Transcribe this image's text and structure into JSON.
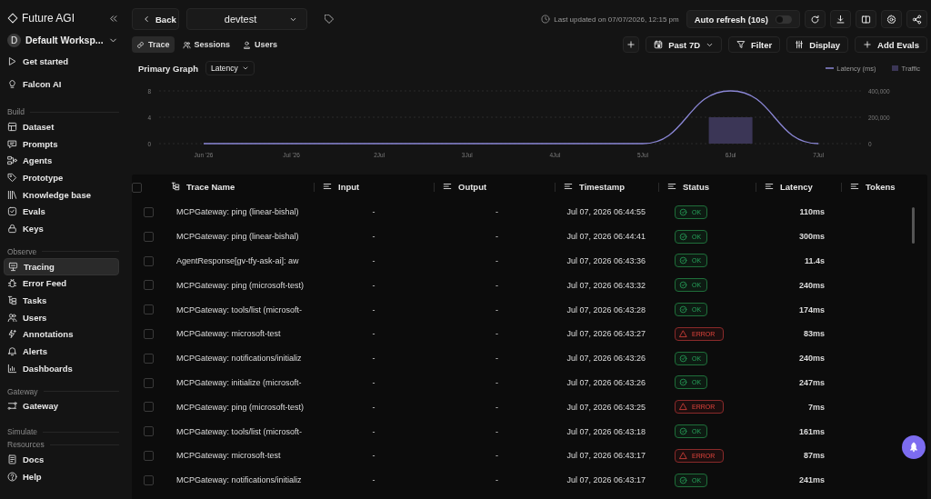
{
  "app": {
    "name": "Future AGI"
  },
  "workspace": {
    "initial": "D",
    "name": "Default Worksp..."
  },
  "sidebar": {
    "top_items": [
      {
        "label": "Get started",
        "selected": false
      },
      {
        "label": "Falcon AI",
        "selected": false
      }
    ],
    "sections": [
      {
        "title": "Build",
        "items": [
          {
            "label": "Dataset",
            "selected": false
          },
          {
            "label": "Prompts",
            "selected": false
          },
          {
            "label": "Agents",
            "selected": false
          },
          {
            "label": "Prototype",
            "selected": false
          },
          {
            "label": "Knowledge base",
            "selected": false
          },
          {
            "label": "Evals",
            "selected": false
          },
          {
            "label": "Keys",
            "selected": false
          }
        ]
      },
      {
        "title": "Observe",
        "items": [
          {
            "label": "Tracing",
            "selected": true
          },
          {
            "label": "Error Feed",
            "selected": false
          },
          {
            "label": "Tasks",
            "selected": false
          },
          {
            "label": "Users",
            "selected": false
          },
          {
            "label": "Annotations",
            "selected": false
          },
          {
            "label": "Alerts",
            "selected": false
          },
          {
            "label": "Dashboards",
            "selected": false
          }
        ]
      },
      {
        "title": "Gateway",
        "items": [
          {
            "label": "Gateway",
            "selected": false
          }
        ]
      },
      {
        "title": "Simulate"
      },
      {
        "title": "Resources",
        "items": [
          {
            "label": "Docs",
            "selected": false
          },
          {
            "label": "Help",
            "selected": false
          }
        ]
      }
    ]
  },
  "topbar": {
    "back": "Back",
    "project": "devtest",
    "last_updated": "Last updated on 07/07/2026, 12:15 pm",
    "auto_refresh": {
      "label": "Auto refresh (10s)",
      "on": false
    }
  },
  "tabs": [
    {
      "label": "Trace",
      "selected": true
    },
    {
      "label": "Sessions",
      "selected": false
    },
    {
      "label": "Users",
      "selected": false
    }
  ],
  "actions": {
    "range": "Past 7D",
    "filter": "Filter",
    "display": "Display",
    "add_evals": "Add Evals"
  },
  "graph": {
    "title": "Primary Graph",
    "metric": "Latency",
    "chart_data": {
      "type": "line",
      "categories": [
        "Jun '26",
        "Jul '26",
        "2Jul",
        "3Jul",
        "4Jul",
        "5Jul",
        "6Jul",
        "7Jul"
      ],
      "series": [
        {
          "name": "Latency (ms)",
          "color": "#8b87d6",
          "axis": "y2",
          "values": [
            0,
            0,
            0,
            0,
            0,
            0,
            400000,
            0
          ]
        },
        {
          "name": "Traffic",
          "color": "#3b3656",
          "type": "bar",
          "values": [
            0,
            0,
            0,
            0,
            0,
            0,
            4,
            0
          ]
        }
      ],
      "ylim": [
        0,
        8
      ],
      "yticks": [
        0,
        4,
        8
      ],
      "y2lim": [
        0,
        400000
      ],
      "y2ticks": [
        {
          "value": 0,
          "label": "0"
        },
        {
          "value": 200000,
          "label": "200,000"
        },
        {
          "value": 400000,
          "label": "400,000"
        }
      ]
    }
  },
  "table": {
    "select_all_checked": false,
    "columns": [
      "Trace Name",
      "Input",
      "Output",
      "Timestamp",
      "Status",
      "Latency",
      "Tokens"
    ],
    "rows": [
      {
        "checked": false,
        "name": "MCPGateway: ping (linear-bishal)",
        "input": "-",
        "output": "-",
        "timestamp": "Jul 07, 2026 06:44:55",
        "status": "OK",
        "kind": "ok",
        "latency": "110ms"
      },
      {
        "checked": false,
        "name": "MCPGateway: ping (linear-bishal)",
        "input": "-",
        "output": "-",
        "timestamp": "Jul 07, 2026 06:44:41",
        "status": "OK",
        "kind": "ok",
        "latency": "300ms"
      },
      {
        "checked": false,
        "name": "AgentResponse[gv-tfy-ask-ai]: aw",
        "input": "-",
        "output": "-",
        "timestamp": "Jul 07, 2026 06:43:36",
        "status": "OK",
        "kind": "ok",
        "latency": "11.4s"
      },
      {
        "checked": false,
        "name": "MCPGateway: ping (microsoft-test)",
        "input": "-",
        "output": "-",
        "timestamp": "Jul 07, 2026 06:43:32",
        "status": "OK",
        "kind": "ok",
        "latency": "240ms"
      },
      {
        "checked": false,
        "name": "MCPGateway: tools/list (microsoft-",
        "input": "-",
        "output": "-",
        "timestamp": "Jul 07, 2026 06:43:28",
        "status": "OK",
        "kind": "ok",
        "latency": "174ms"
      },
      {
        "checked": false,
        "name": "MCPGateway: microsoft-test",
        "input": "-",
        "output": "-",
        "timestamp": "Jul 07, 2026 06:43:27",
        "status": "ERROR",
        "kind": "error",
        "latency": "83ms"
      },
      {
        "checked": false,
        "name": "MCPGateway: notifications/initializ",
        "input": "-",
        "output": "-",
        "timestamp": "Jul 07, 2026 06:43:26",
        "status": "OK",
        "kind": "ok",
        "latency": "240ms"
      },
      {
        "checked": false,
        "name": "MCPGateway: initialize (microsoft-",
        "input": "-",
        "output": "-",
        "timestamp": "Jul 07, 2026 06:43:26",
        "status": "OK",
        "kind": "ok",
        "latency": "247ms"
      },
      {
        "checked": false,
        "name": "MCPGateway: ping (microsoft-test)",
        "input": "-",
        "output": "-",
        "timestamp": "Jul 07, 2026 06:43:25",
        "status": "ERROR",
        "kind": "error",
        "latency": "7ms"
      },
      {
        "checked": false,
        "name": "MCPGateway: tools/list (microsoft-",
        "input": "-",
        "output": "-",
        "timestamp": "Jul 07, 2026 06:43:18",
        "status": "OK",
        "kind": "ok",
        "latency": "161ms"
      },
      {
        "checked": false,
        "name": "MCPGateway: microsoft-test",
        "input": "-",
        "output": "-",
        "timestamp": "Jul 07, 2026 06:43:17",
        "status": "ERROR",
        "kind": "error",
        "latency": "87ms"
      },
      {
        "checked": false,
        "name": "MCPGateway: notifications/initializ",
        "input": "-",
        "output": "-",
        "timestamp": "Jul 07, 2026 06:43:17",
        "status": "OK",
        "kind": "ok",
        "latency": "241ms"
      }
    ]
  }
}
